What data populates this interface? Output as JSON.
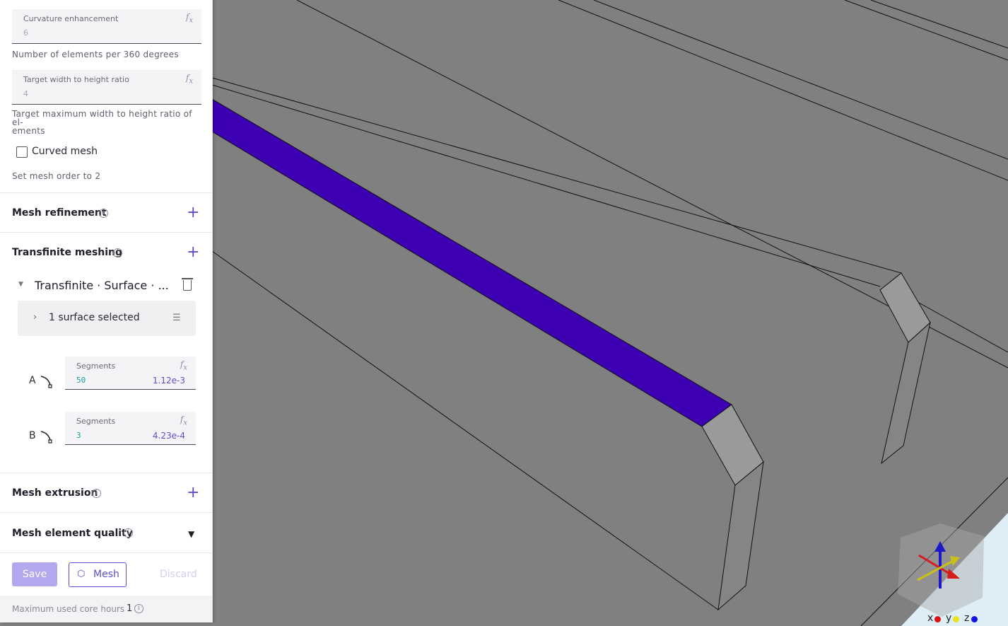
{
  "panel": {
    "curvature": {
      "label": "Curvature enhancement",
      "value": "6",
      "help": "Number of elements per 360 degrees",
      "fx": "fx"
    },
    "ratio": {
      "label": "Target width to height ratio",
      "value": "4",
      "help": "Target maximum width to height ratio of el-\nements",
      "fx": "fx"
    },
    "curved_mesh": {
      "label": "Curved mesh",
      "checked": false,
      "help": "Set mesh order to 2"
    },
    "sections": {
      "refinement": "Mesh refinement",
      "transfinite": "Transfinite meshing",
      "extrusion": "Mesh extrusion",
      "quality": "Mesh element quality"
    },
    "transfinite_item": {
      "title": "Transfinite · Surface · ...",
      "selection": "1 surface selected",
      "edge_a": {
        "letter": "A",
        "label": "Segments",
        "value": "50",
        "length": "1.12e-3"
      },
      "edge_b": {
        "letter": "B",
        "label": "Segments",
        "value": "3",
        "length": "4.23e-4"
      }
    },
    "actions": {
      "save": "Save",
      "mesh": "Mesh",
      "discard": "Discard"
    },
    "footer": {
      "text": "Maximum used core hours",
      "value": "1"
    }
  },
  "axes": {
    "x": "x",
    "y": "y",
    "z": "z"
  },
  "colors": {
    "accent": "#5b4fd0",
    "selected_face": "#3d00b3",
    "model": "#808080",
    "end_face": "#9a9a9a"
  }
}
